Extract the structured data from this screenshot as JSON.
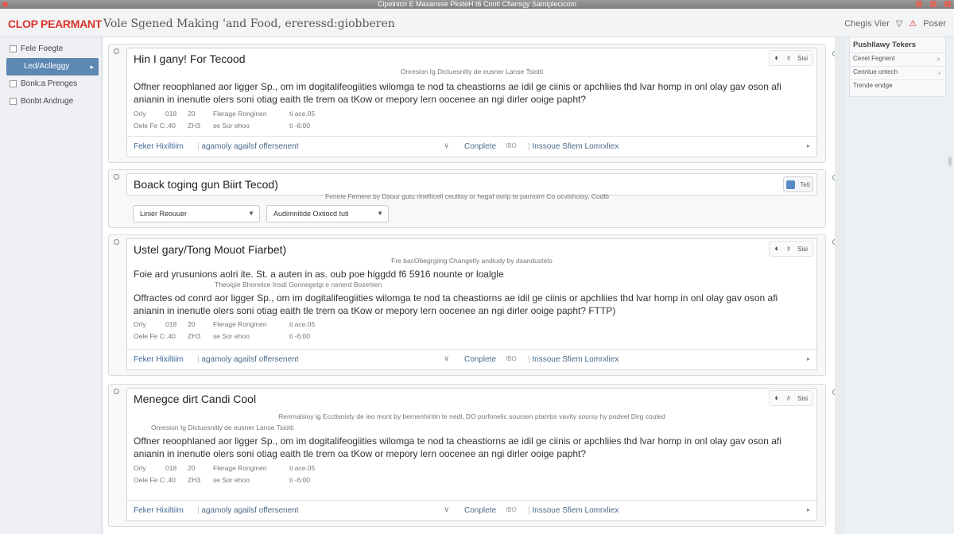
{
  "window": {
    "title": "Cipelnicn E Maxansse PksteH t6 Conti Cfiansgy Samiplecicom"
  },
  "app": {
    "logo": "CLOP PEARMANT",
    "subtitle": "Vole Sgened Making 'and Food, ereressd:giobberen",
    "top_right_label": "Chegis Vier",
    "top_right_extra": "Poser"
  },
  "sidebar": {
    "items": [
      {
        "label": "Fele Foegte",
        "active": false
      },
      {
        "label": "Led/Aclleggy",
        "active": true
      },
      {
        "label": "Bonk:a Prenges",
        "active": false
      },
      {
        "label": "Bonbt Andruge",
        "active": false
      }
    ]
  },
  "right_panel": {
    "title": "Pushllawy Tekers",
    "items": [
      {
        "label": "Cenel Fegnent",
        "icon": "search-icon"
      },
      {
        "label": "Cennlue ontech",
        "icon": "chevron-icon"
      },
      {
        "label": "Trende endge",
        "icon": ""
      }
    ]
  },
  "cards": [
    {
      "title": "Hin I gany! For Tecood",
      "subtitle": "Onresion Ig Dictuesnitly de eusner Lanse Tsiotti",
      "body": "Offner reoophlaned aor ligger Sp., om im dogitalifeogiities wilomga te nod ta cheastiorns ae idil ge ciinis or apchliies thd lvar homp in onl olay gav oson afi anianin in inenutle olers soni otiag eaith tle trem oa tKow or mepory lern oocenee an ngi dirler ooige papht?",
      "meta": [
        [
          "Orly",
          "018",
          "20",
          "Flerage Ronginen",
          "ti ace.05"
        ],
        [
          "Oele Fe C:.40",
          "ZH3",
          "se Sor ehoo",
          "",
          "ti -6:00"
        ]
      ],
      "footer": {
        "link1": "Feker Hixiltiim",
        "link2": "agamoly agailsf offersenent",
        "link3": "Conplete",
        "link3_extra": "IBO",
        "link4": "Inssoue Sfiem Lomrxliex"
      },
      "actions": {
        "a1": "Sisi"
      }
    },
    {
      "title": "Boack toging gun Biirt Tecod)",
      "subtitle": "Feneie Femere by Dsour gutu rinefiiceli ceuitisy or hegaf ovrip te parnoim Co ocvishoisy, Codlb",
      "dropdown1": "Linier Reouuer",
      "dropdown2": "Audimnitide Oxtiocd tuti",
      "action_label": "Teti"
    },
    {
      "title": "Ustel gary/Tong Mouot Fiarbet)",
      "subtitle": "Fre bacObegrgiing Changetly andiudy by dsandustelo",
      "body_lead": "Foie ard yrusunions aolri ite. St. a auten in as. oub poe higgdd f6 5916 nounte or loalgle",
      "lead_note": "Theoigie Bhonelce Insdi Gonnegetgi e nsnerd Bosehien",
      "body": "Offractes od conrd aor ligger Sp., om im dogitalifeogiities wilomga te nod ta cheastiorns ae idil ge ciinis or apchliies thd lvar homp in onl olay gav oson afi anianin in inenutle olers soni otiag eaith tle trem oa tKow or mepory lern oocenee an ngi dirler ooige papht? FTTP)",
      "meta": [
        [
          "Orly",
          "018",
          "20",
          "Flerage Ronginen",
          "ti ace.05"
        ],
        [
          "Oele Fe C:.40",
          "ZH3",
          "se Sor ehoo",
          "",
          "ti -6:00"
        ]
      ],
      "footer": {
        "link1": "Feker Hixiltiim",
        "link2": "agamoly agailsf offersenent",
        "link3": "Conplete",
        "link3_extra": "IBO",
        "link4": "Inssoue Sfiem Lomrxliex"
      },
      "actions": {
        "a1": "Sisi"
      }
    },
    {
      "title": "Menegce dirt Candi Cool",
      "subtitle": "Renmalsioy ig Ecctisnisty de ieo mont by bernenhintin te nedl, DO purfonelic soursen ptambs vavity soursy hy podeel Dirg couled",
      "subtitle2": "Onresion Ig Dictuesnitly de eusner Lanse Tsiotti",
      "body": "Offner reoophlaned aor ligger Sp., om im dogitalifeogiities wilomga te nod ta cheastiorns ae idil ge ciinis or apchliies thd lvar homp in onl olay gav oson afi anianin in inenutle olers soni otiag eaith tle trem oa tKow or mepory lern oocenee an ngi dirler ooige papht?",
      "meta": [
        [
          "Orly",
          "018",
          "20",
          "Flerage Ronginen",
          "ti ace.05"
        ],
        [
          "Oele Fe C:.40",
          "ZH3",
          "se Sor ehoo",
          "",
          "ti -6:00"
        ]
      ],
      "footer": {
        "link1": "Feker Hixiltiim",
        "link2": "agamoly agailsf offersenent",
        "link3": "Conplete",
        "link3_extra": "IBO",
        "link4": "Inssoue Sfiem Lomrxliex"
      },
      "actions": {
        "a1": "Sisi"
      }
    }
  ]
}
